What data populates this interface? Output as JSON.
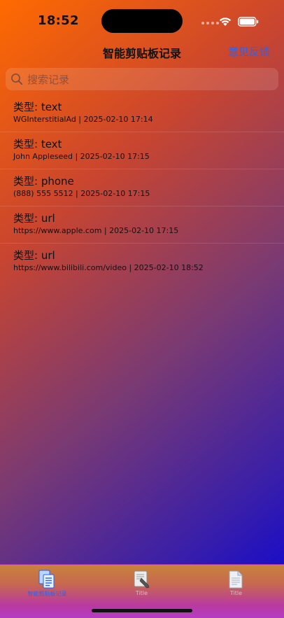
{
  "status_bar": {
    "time": "18:52",
    "icons": [
      "cellular-dots-icon",
      "wifi-icon",
      "battery-icon"
    ]
  },
  "nav": {
    "title": "智能剪贴板记录",
    "right_button": "意见反馈"
  },
  "search": {
    "placeholder": "搜索记录",
    "value": ""
  },
  "records": [
    {
      "title": "类型: text",
      "subtitle": "WGInterstitialAd | 2025-02-10 17:14"
    },
    {
      "title": "类型: text",
      "subtitle": "John Appleseed | 2025-02-10 17:15"
    },
    {
      "title": "类型: phone",
      "subtitle": "(888) 555 5512 | 2025-02-10 17:15"
    },
    {
      "title": "类型: url",
      "subtitle": "https://www.apple.com | 2025-02-10 17:15"
    },
    {
      "title": "类型: url",
      "subtitle": "https://www.bilibili.com/video | 2025-02-10 18:52"
    }
  ],
  "tabs": [
    {
      "label": "智能剪贴板记录",
      "icon": "document-list-icon",
      "selected": true
    },
    {
      "label": "Title",
      "icon": "edit-document-icon",
      "selected": false
    },
    {
      "label": "Title",
      "icon": "document-icon",
      "selected": false
    }
  ],
  "colors": {
    "accent": "#1e66ff",
    "gradient_start": "#ff6a00",
    "gradient_end": "#0a05d6"
  }
}
